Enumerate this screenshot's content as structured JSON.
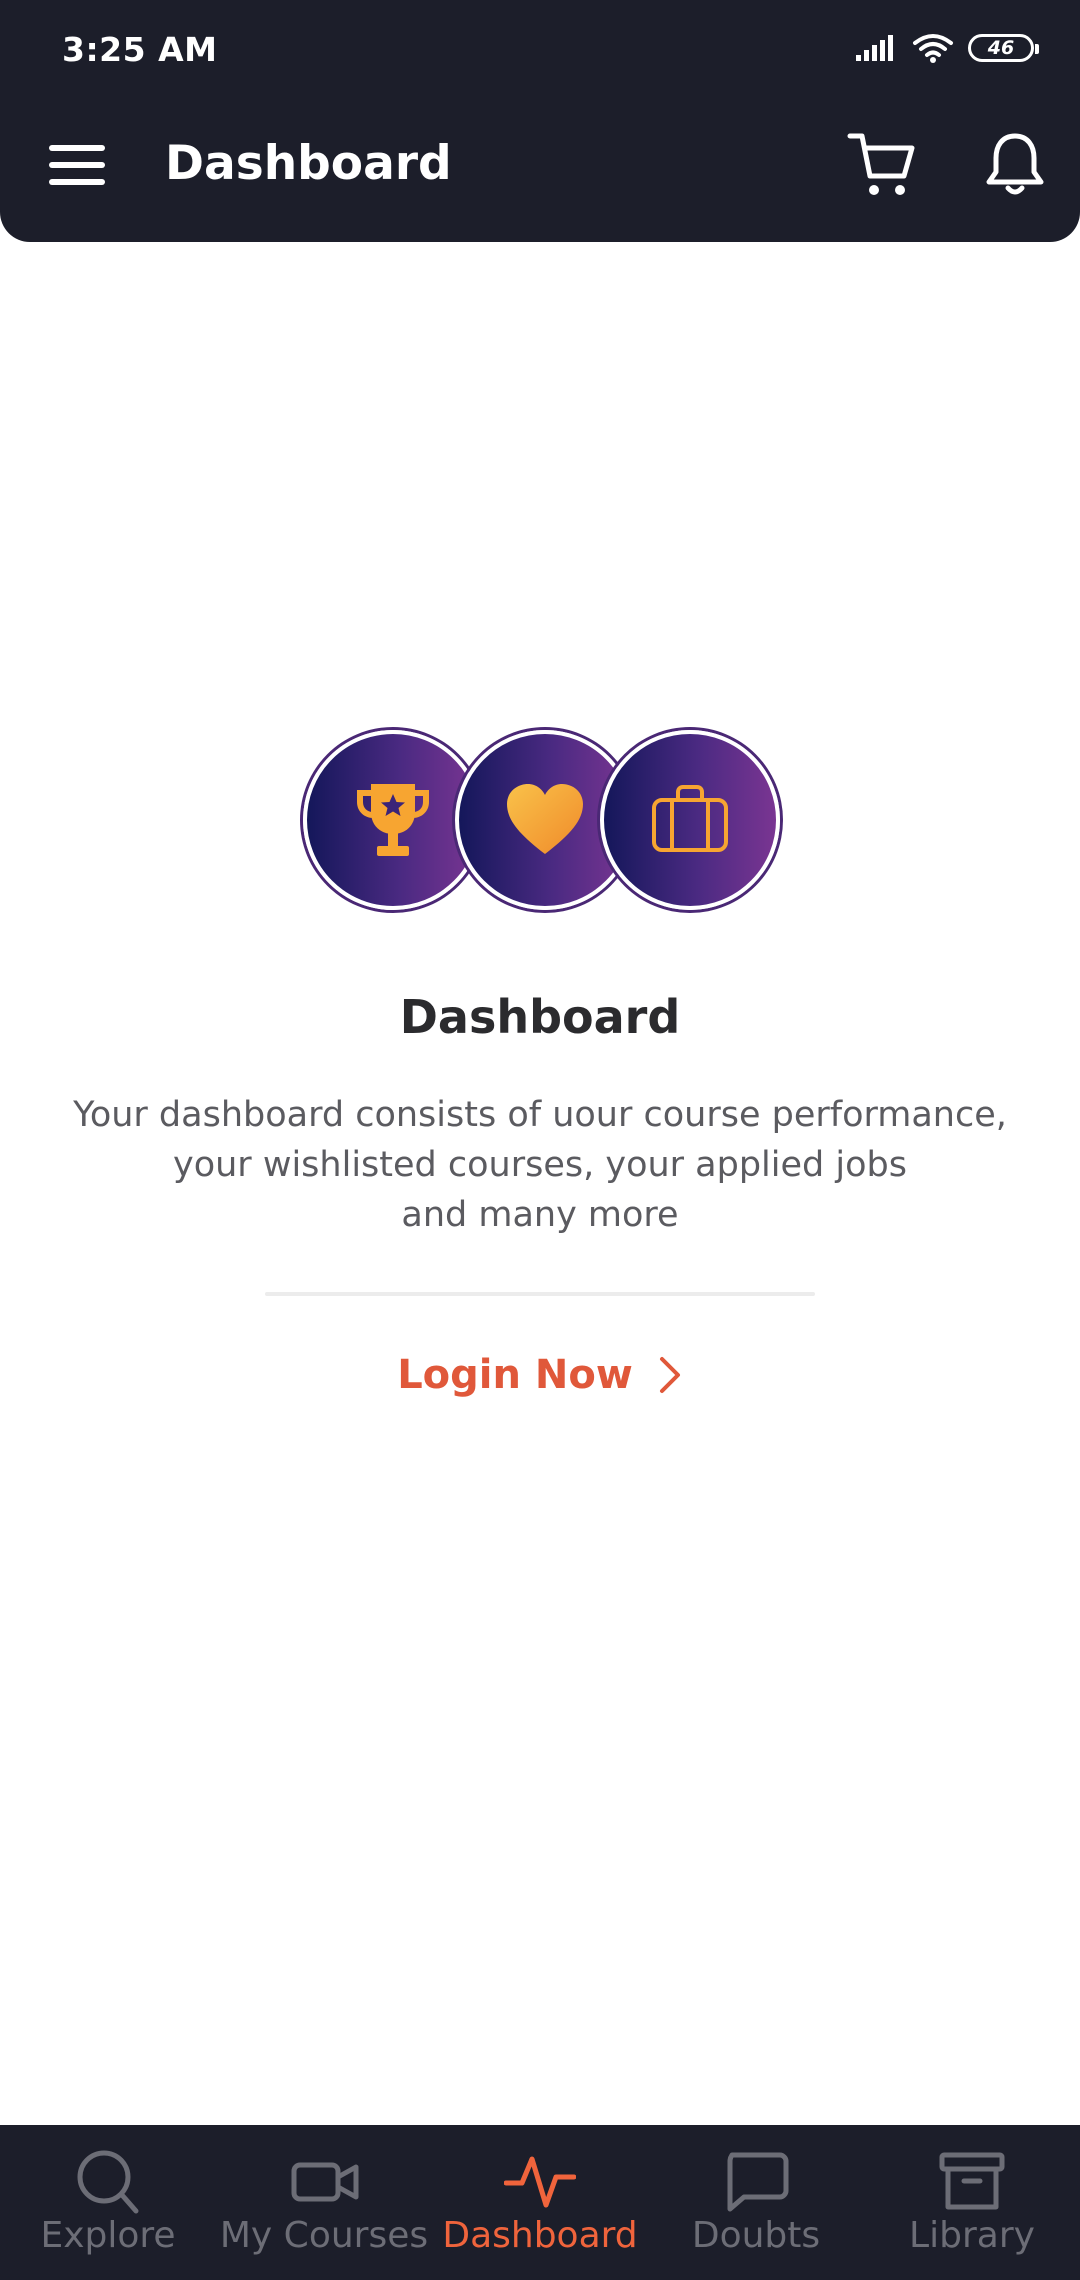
{
  "status_bar": {
    "time": "3:25 AM",
    "battery": "46"
  },
  "header": {
    "title": "Dashboard"
  },
  "empty_state": {
    "title": "Dashboard",
    "description_lines": [
      "Your dashboard consists of uour course performance,",
      "your wishlisted courses, your applied jobs",
      "and many more"
    ],
    "login_label": "Login Now"
  },
  "bottom_nav": {
    "items": [
      {
        "label": "Explore",
        "icon": "search-icon"
      },
      {
        "label": "My Courses",
        "icon": "video-icon"
      },
      {
        "label": "Dashboard",
        "icon": "activity-icon",
        "active": true
      },
      {
        "label": "Doubts",
        "icon": "chat-icon"
      },
      {
        "label": "Library",
        "icon": "archive-icon"
      }
    ]
  },
  "colors": {
    "header_bg": "#1c1e2a",
    "accent": "#e0583a",
    "nav_inactive": "#6c6d76",
    "icon_orange": "#f7a531"
  }
}
